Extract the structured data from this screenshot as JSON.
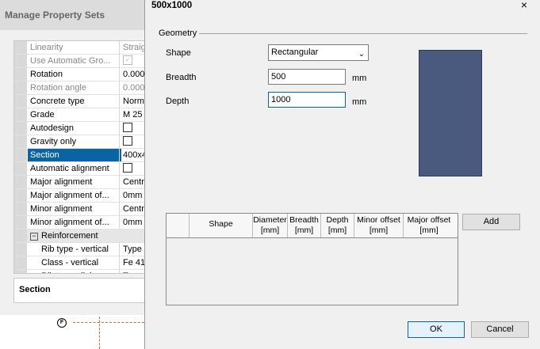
{
  "background": {
    "title": "Manage Property Sets",
    "rows": [
      {
        "name": "Linearity",
        "value": "Straig",
        "state": "dim"
      },
      {
        "name": "Use Automatic Gro...",
        "value": "",
        "state": "dim-check"
      },
      {
        "name": "Rotation",
        "value": "0.000",
        "state": ""
      },
      {
        "name": "Rotation angle",
        "value": "0.000",
        "state": "dim"
      },
      {
        "name": "Concrete type",
        "value": "Norma",
        "state": ""
      },
      {
        "name": "Grade",
        "value": "M 25",
        "state": ""
      },
      {
        "name": "Autodesign",
        "value": "",
        "state": "check"
      },
      {
        "name": "Gravity only",
        "value": "",
        "state": "check"
      },
      {
        "name": "Section",
        "value": "400x4",
        "state": "sel"
      },
      {
        "name": "Automatic alignment",
        "value": "",
        "state": "check"
      },
      {
        "name": "Major alignment",
        "value": "Centr",
        "state": ""
      },
      {
        "name": "Major alignment of...",
        "value": "0mm",
        "state": ""
      },
      {
        "name": "Minor alignment",
        "value": "Centr",
        "state": ""
      },
      {
        "name": "Minor alignment of...",
        "value": "0mm",
        "state": ""
      },
      {
        "name": "Reinforcement",
        "value": "",
        "state": "grp"
      },
      {
        "name": "Rib type - vertical",
        "value": "Type",
        "state": "indent"
      },
      {
        "name": "Class - vertical",
        "value": "Fe 41",
        "state": "indent"
      },
      {
        "name": "Rib type - link",
        "value": "Type",
        "state": "indent"
      }
    ],
    "section_label": "Section",
    "marker_glyph": "F"
  },
  "dialog": {
    "title": "500x1000",
    "close_glyph": "×",
    "group_label": "Geometry",
    "shape_label": "Shape",
    "shape_value": "Rectangular",
    "breadth_label": "Breadth",
    "breadth_value": "500",
    "breadth_unit": "mm",
    "depth_label": "Depth",
    "depth_value": "1000",
    "depth_unit": "mm",
    "preview_color": "#4a5a7f",
    "table_columns": [
      {
        "line1": "",
        "line2": ""
      },
      {
        "line1": "Shape",
        "line2": ""
      },
      {
        "line1": "Diameter",
        "line2": "[mm]"
      },
      {
        "line1": "Breadth",
        "line2": "[mm]"
      },
      {
        "line1": "Depth",
        "line2": "[mm]"
      },
      {
        "line1": "Minor offset",
        "line2": "[mm]"
      },
      {
        "line1": "Major offset",
        "line2": "[mm]"
      }
    ],
    "add_label": "Add",
    "ok_label": "OK",
    "cancel_label": "Cancel"
  }
}
